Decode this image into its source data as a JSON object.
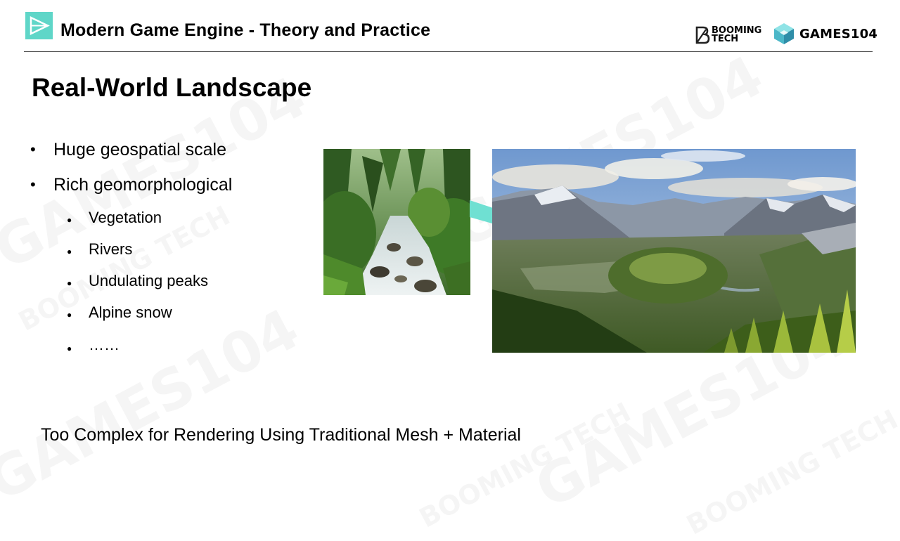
{
  "header": {
    "course_title": "Modern Game Engine - Theory and Practice",
    "logo_booming_tech": "BOOMING TECH",
    "logo_booming_line1": "BOOMING",
    "logo_booming_line2": "TECH",
    "logo_games104": "GAMES104"
  },
  "slide": {
    "title": "Real-World Landscape",
    "bullets": [
      "Huge geospatial scale",
      "Rich geomorphological"
    ],
    "sub_bullets": [
      "Vegetation",
      "Rivers",
      "Undulating peaks",
      "Alpine snow",
      "……"
    ],
    "footer_note": "Too Complex for Rendering Using Traditional Mesh + Material"
  },
  "images": {
    "left": "mountain stream in forest photo",
    "right": "mountain valley landscape photo"
  },
  "colors": {
    "accent": "#5fd6c8",
    "callout": "#6fe0d2",
    "header_rule": "#4a4a4a"
  },
  "watermark": {
    "text1": "GAMES104",
    "text2": "BOOMING TECH"
  }
}
